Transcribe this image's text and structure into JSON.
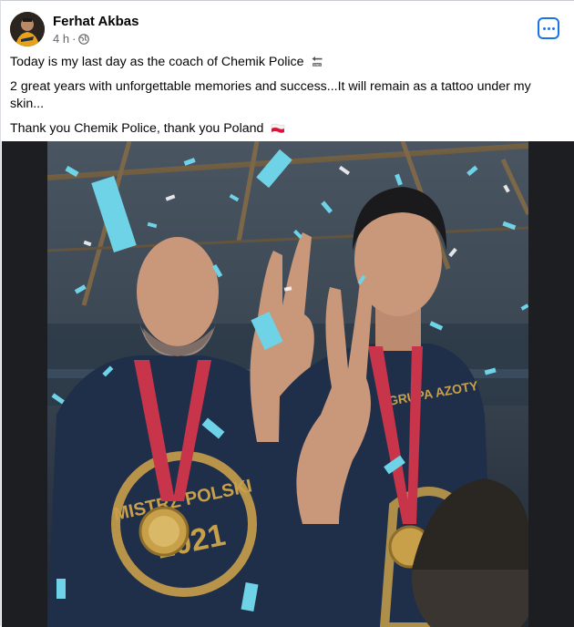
{
  "post": {
    "author_name": "Ferhat Akbas",
    "timestamp": "4 h",
    "separator": "·",
    "privacy_icon": "globe-icon",
    "more_icon": "more-options-icon",
    "paragraphs": [
      "Today is my last day as the coach of Chemik Police",
      "2 great years with unforgettable memories and success...It will remain as a tattoo under my skin...",
      "Thank you Chemik Police, thank you Poland"
    ],
    "emoji": {
      "first": "end-arrow-emoji",
      "last": "poland-flag-emoji"
    },
    "photo": {
      "jersey_sponsor": "GRUPA AZOTY",
      "jersey_text": "MISTRZ POLSKI",
      "jersey_year": "2021"
    }
  },
  "colors": {
    "accent": "#1b74e4",
    "secondary_text": "#65676b",
    "confetti": "#6fd3e8",
    "jersey": "#1f2f4a",
    "gold": "#c8a04a",
    "lanyard": "#c8344a"
  }
}
